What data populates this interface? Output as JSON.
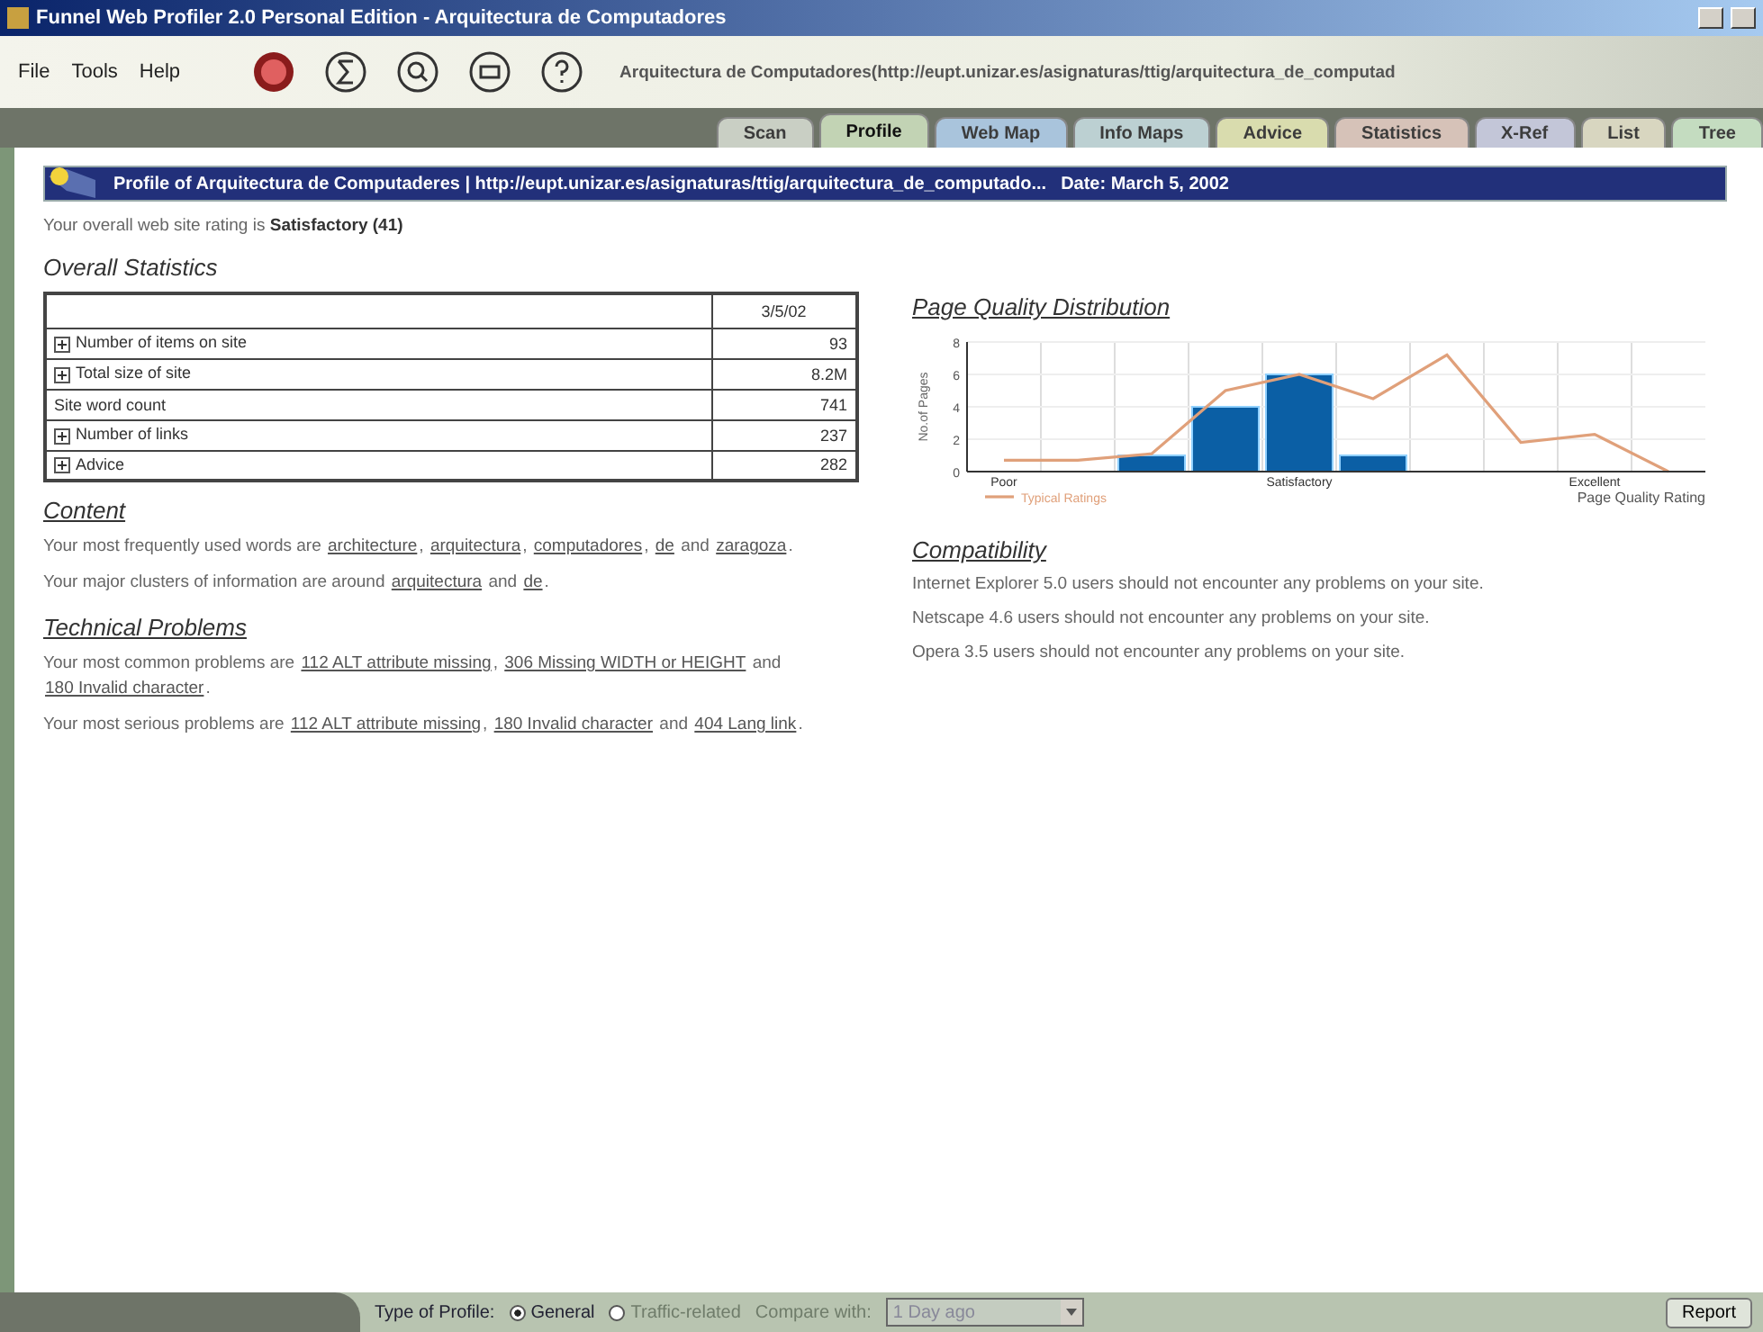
{
  "window": {
    "title": "Funnel Web Profiler 2.0 Personal Edition - Arquitectura de Computadores"
  },
  "menu": [
    "File",
    "Tools",
    "Help"
  ],
  "toolbar": {
    "site_url": "Arquitectura de Computadores(http://eupt.unizar.es/asignaturas/ttig/arquitectura_de_computad"
  },
  "tabs": [
    {
      "label": "Scan",
      "selected": false,
      "color": "#c9cfc4"
    },
    {
      "label": "Profile",
      "selected": true,
      "color": "#c2d3b4"
    },
    {
      "label": "Web Map",
      "selected": false,
      "color": "#a9c4dc"
    },
    {
      "label": "Info Maps",
      "selected": false,
      "color": "#bcd0d2"
    },
    {
      "label": "Advice",
      "selected": false,
      "color": "#d9dcae"
    },
    {
      "label": "Statistics",
      "selected": false,
      "color": "#d6c2b8"
    },
    {
      "label": "X-Ref",
      "selected": false,
      "color": "#c3c6d8"
    },
    {
      "label": "List",
      "selected": false,
      "color": "#d8d6c0"
    },
    {
      "label": "Tree",
      "selected": false,
      "color": "#c4dcc0"
    }
  ],
  "banner": {
    "title": "Profile of Arquitectura de Computaderes | http://eupt.unizar.es/asignaturas/ttig/arquitectura_de_computado...",
    "date": "Date: March 5, 2002"
  },
  "rating": {
    "prefix": "Your overall web site rating is ",
    "value": "Satisfactory (41)"
  },
  "overall_statistics": {
    "heading": "Overall Statistics",
    "date_column": "3/5/02",
    "rows": [
      {
        "label": "Number of items on site",
        "value": "93",
        "kind": "expandable"
      },
      {
        "label": "Total size of site",
        "value": "8.2M",
        "kind": "expandable"
      },
      {
        "label": "Site word count",
        "value": "741",
        "kind": "plain"
      },
      {
        "label": "Number of links",
        "value": "237",
        "kind": "expandable"
      },
      {
        "label": "Advice",
        "value": "282",
        "kind": "expandable"
      }
    ]
  },
  "content": {
    "heading": "Content",
    "paragraphs": [
      [
        {
          "text": "Your most frequently used words are ",
          "kind": "text"
        },
        {
          "text": "architecture",
          "kind": "link"
        },
        {
          "text": ", ",
          "kind": "text"
        },
        {
          "text": "arquitectura",
          "kind": "link"
        },
        {
          "text": ", ",
          "kind": "text"
        },
        {
          "text": "computadores",
          "kind": "link"
        },
        {
          "text": ", ",
          "kind": "text"
        },
        {
          "text": "de",
          "kind": "link"
        },
        {
          "text": " and ",
          "kind": "text"
        },
        {
          "text": "zaragoza",
          "kind": "link"
        },
        {
          "text": ".",
          "kind": "text"
        }
      ],
      [
        {
          "text": "Your major clusters of information are around ",
          "kind": "text"
        },
        {
          "text": "arquitectura",
          "kind": "link"
        },
        {
          "text": " and ",
          "kind": "text"
        },
        {
          "text": "de",
          "kind": "link"
        },
        {
          "text": ".",
          "kind": "text"
        }
      ]
    ]
  },
  "technical_problems": {
    "heading": "Technical Problems",
    "paragraphs": [
      [
        {
          "text": "Your most common problems are ",
          "kind": "text"
        },
        {
          "text": "112 ALT attribute missing",
          "kind": "link"
        },
        {
          "text": ", ",
          "kind": "text"
        },
        {
          "text": "306 Missing WIDTH or HEIGHT",
          "kind": "link"
        },
        {
          "text": " and ",
          "kind": "text"
        },
        {
          "text": "180 Invalid character",
          "kind": "link"
        },
        {
          "text": ".",
          "kind": "text"
        }
      ],
      [
        {
          "text": "Your most serious problems are ",
          "kind": "text"
        },
        {
          "text": "112 ALT attribute missing",
          "kind": "link"
        },
        {
          "text": ", ",
          "kind": "text"
        },
        {
          "text": "180 Invalid character",
          "kind": "link"
        },
        {
          "text": " and ",
          "kind": "text"
        },
        {
          "text": "404 Lang link",
          "kind": "link"
        },
        {
          "text": ".",
          "kind": "text"
        }
      ]
    ]
  },
  "page_quality": {
    "heading": "Page Quality Distribution",
    "chart_data": {
      "type": "bar",
      "xlabel": "Page Quality Rating",
      "ylabel": "No.of Pages",
      "categories": [
        "Poor",
        null,
        null,
        null,
        "Satisfactory",
        null,
        null,
        null,
        "Excellent",
        null
      ],
      "ylim": [
        0,
        8
      ],
      "yticks": [
        0,
        2,
        4,
        6,
        8
      ],
      "grid": true,
      "series": [
        {
          "type": "bar",
          "color": "#0b5fa5",
          "values": [
            0,
            0,
            1,
            4,
            6,
            1,
            0,
            0,
            0,
            0
          ]
        },
        {
          "type": "line",
          "name": "Typical Ratings",
          "color": "#e0a07a",
          "values": [
            0.7,
            0.7,
            1.1,
            5,
            6,
            4.5,
            7.2,
            1.8,
            2.3,
            0
          ]
        }
      ]
    }
  },
  "compatibility": {
    "heading": "Compatibility",
    "lines": [
      "Internet Explorer 5.0 users should not encounter any problems on your site.",
      "Netscape 4.6 users should not encounter any problems on your site.",
      "Opera 3.5 users should not encounter any problems on your site."
    ]
  },
  "status_bar": {
    "type_label": "Type of Profile:",
    "options": [
      {
        "label": "General",
        "selected": true,
        "disabled": false
      },
      {
        "label": "Traffic-related",
        "selected": false,
        "disabled": true
      }
    ],
    "compare_label": "Compare with:",
    "compare_value": "1 Day ago",
    "compare_disabled": true,
    "report_button": "Report"
  }
}
